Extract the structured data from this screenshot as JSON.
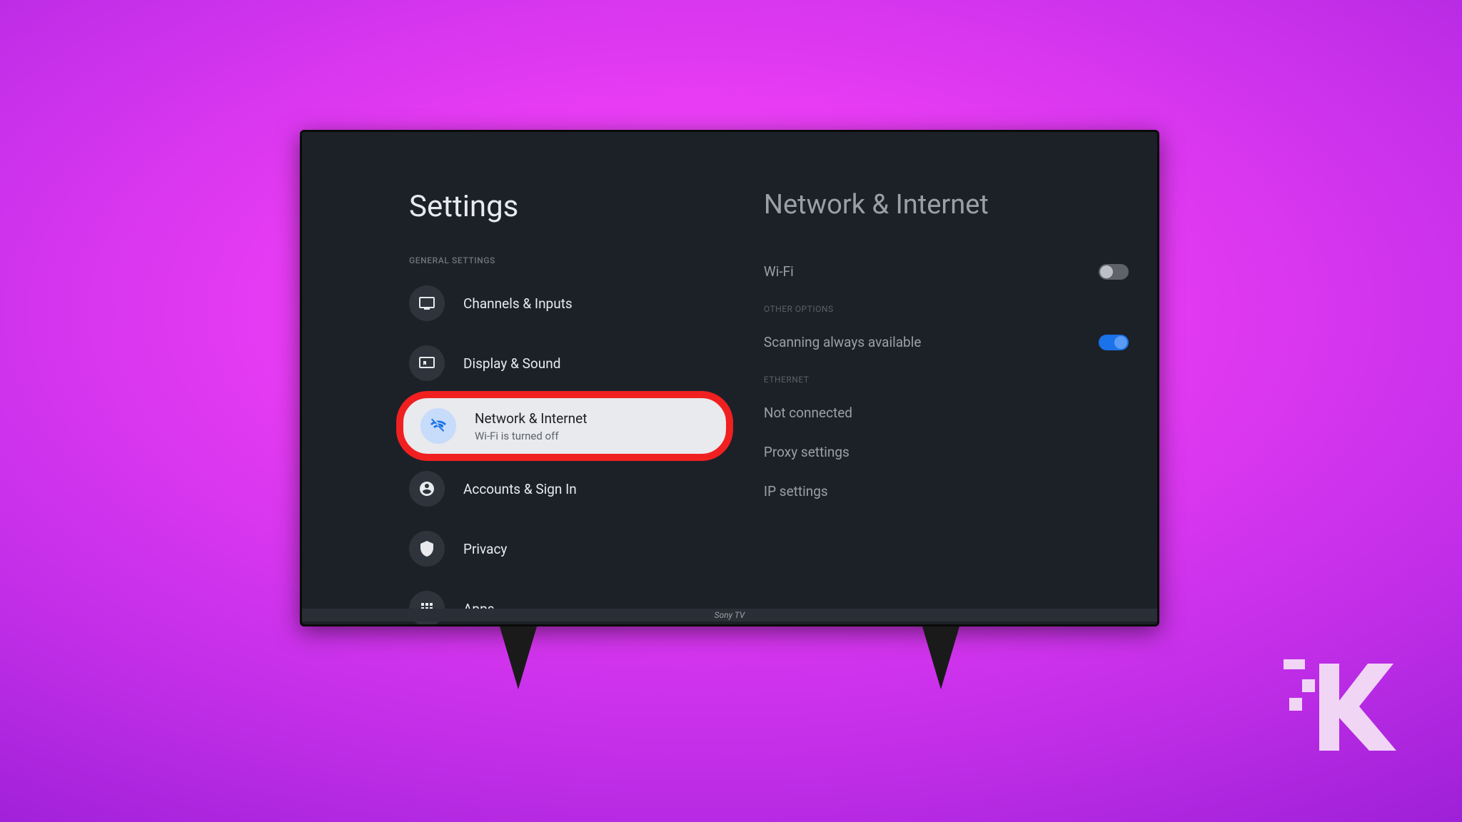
{
  "caption": "Sony TV",
  "settings": {
    "title": "Settings",
    "general_label": "GENERAL SETTINGS",
    "items": [
      {
        "label": "Channels & Inputs",
        "sub": ""
      },
      {
        "label": "Display & Sound",
        "sub": ""
      },
      {
        "label": "Network & Internet",
        "sub": "Wi-Fi is turned off"
      },
      {
        "label": "Accounts & Sign In",
        "sub": ""
      },
      {
        "label": "Privacy",
        "sub": ""
      },
      {
        "label": "Apps",
        "sub": ""
      }
    ]
  },
  "detail": {
    "title": "Network & Internet",
    "wifi_label": "Wi-Fi",
    "wifi_on": false,
    "other_label": "OTHER OPTIONS",
    "scanning_label": "Scanning always available",
    "scanning_on": true,
    "ethernet_label": "ETHERNET",
    "ethernet_status": "Not connected",
    "proxy_label": "Proxy settings",
    "ip_label": "IP settings"
  }
}
